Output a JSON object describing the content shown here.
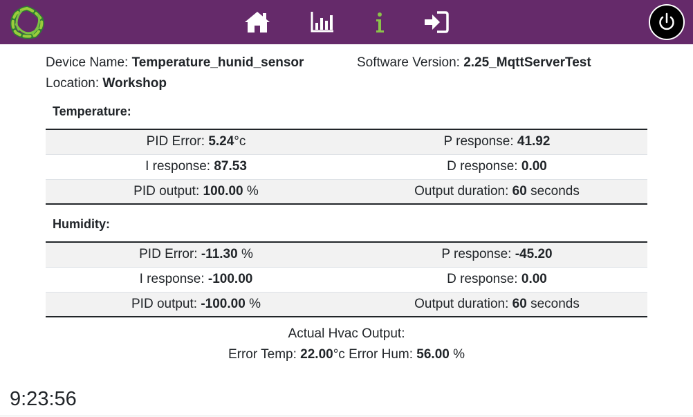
{
  "device": {
    "name_label": "Device Name:",
    "name_value": "Temperature_hunid_sensor",
    "version_label": "Software Version:",
    "version_value": "2.25_MqttServerTest",
    "location_label": "Location:",
    "location_value": "Workshop"
  },
  "temperature": {
    "title": "Temperature:",
    "pid_error_label": "PID Error:",
    "pid_error_value": "5.24",
    "pid_error_unit": "°c",
    "p_label": "P response:",
    "p_value": "41.92",
    "i_label": "I response:",
    "i_value": "87.53",
    "d_label": "D response:",
    "d_value": "0.00",
    "output_label": "PID output:",
    "output_value": "100.00",
    "output_unit": "%",
    "duration_label": "Output duration:",
    "duration_value": "60",
    "duration_unit": "seconds"
  },
  "humidity": {
    "title": "Humidity:",
    "pid_error_label": "PID Error:",
    "pid_error_value": "-11.30",
    "pid_error_unit": "%",
    "p_label": "P response:",
    "p_value": "-45.20",
    "i_label": "I response:",
    "i_value": "-100.00",
    "d_label": "D response:",
    "d_value": "0.00",
    "output_label": "PID output:",
    "output_value": "-100.00",
    "output_unit": "%",
    "duration_label": "Output duration:",
    "duration_value": "60",
    "duration_unit": "seconds"
  },
  "hvac": {
    "title": "Actual Hvac Output:",
    "temp_label": "Error Temp:",
    "temp_value": "22.00",
    "temp_unit": "°c",
    "hum_label": "Error Hum:",
    "hum_value": "56.00",
    "hum_unit": "%"
  },
  "clock": "9:23:56",
  "nav": {
    "logo_icon": "app-logo-icon",
    "home_icon": "home-icon",
    "chart_icon": "bar-chart-icon",
    "info_icon": "info-icon",
    "login_icon": "sign-in-icon",
    "power_icon": "power-icon"
  },
  "colors": {
    "navbar": "#652a6a",
    "info_icon": "#8bc34a",
    "logo_green": "#7cc242",
    "logo_dark": "#2e7d32"
  }
}
